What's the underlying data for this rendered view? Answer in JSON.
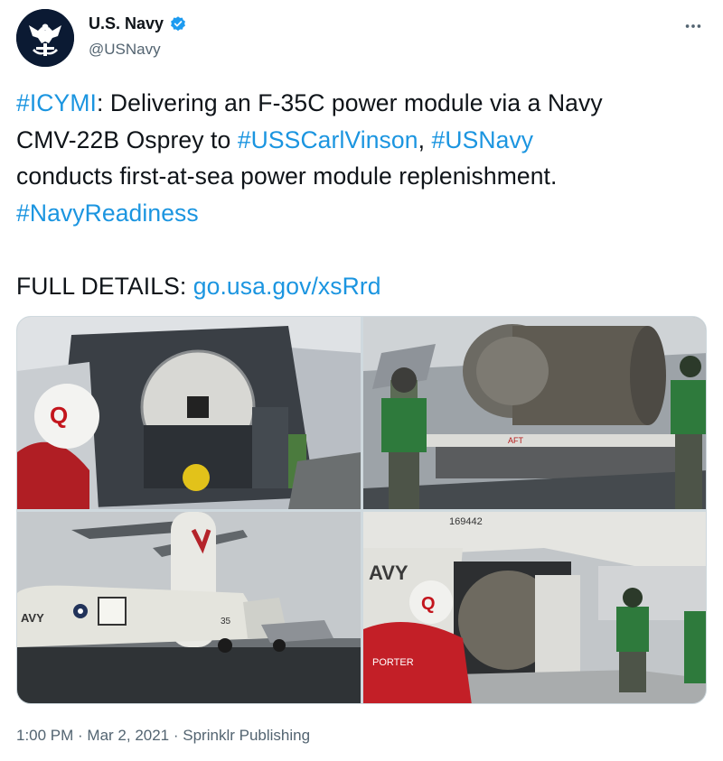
{
  "account": {
    "display_name": "U.S. Navy",
    "handle": "@USNavy",
    "avatar_icon": "navy-eagle-icon",
    "verified_icon": "verified-badge-icon"
  },
  "tweet": {
    "line1": {
      "tag": "#ICYMI",
      "text": ": Delivering an F-35C power module via a Navy"
    },
    "line2": {
      "pre": "CMV-22B Osprey to ",
      "tag1": "#USSCarlVinson",
      "mid": ", ",
      "tag2": "#USNavy"
    },
    "line3": {
      "text": "conducts first-at-sea power module replenishment."
    },
    "line4": {
      "tag": "#NavyReadiness"
    },
    "line5": {
      "label": "FULL DETAILS: ",
      "url": "go.usa.gov/xsRrd"
    }
  },
  "photos": [
    {
      "name": "photo-osprey-cargo-bay",
      "labels": [
        "Q"
      ]
    },
    {
      "name": "photo-power-module-engine",
      "labels": [
        "AFT"
      ]
    },
    {
      "name": "photo-osprey-on-deck",
      "labels": [
        "AVY",
        "35"
      ]
    },
    {
      "name": "photo-module-unloading",
      "labels": [
        "169442",
        "AVY",
        "Q",
        "PORTER"
      ]
    }
  ],
  "meta": {
    "time": "1:00 PM",
    "sep1": " · ",
    "date": "Mar 2, 2021",
    "sep2": " · ",
    "source": "Sprinklr Publishing"
  },
  "colors": {
    "link": "#1b95e0",
    "verified": "#1d9bf0",
    "secondary_text": "#536471"
  }
}
